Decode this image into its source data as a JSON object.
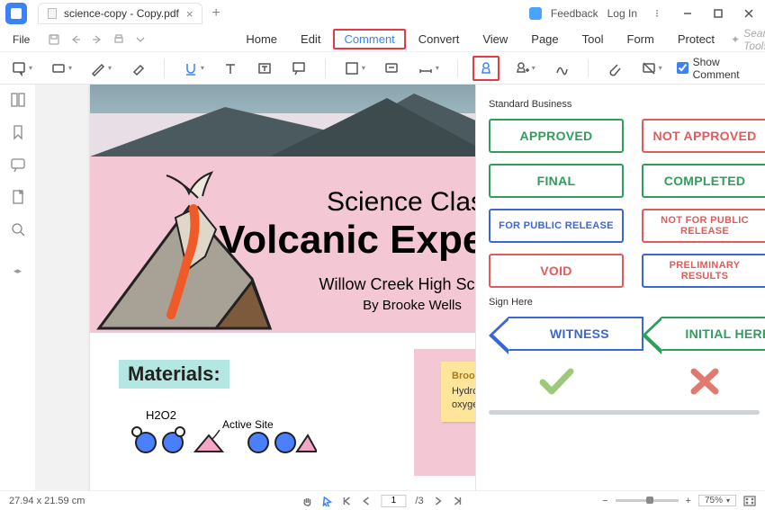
{
  "title": {
    "filename": "science-copy - Copy.pdf",
    "feedback": "Feedback",
    "login": "Log In"
  },
  "menu": {
    "file": "File",
    "tabs": [
      "Home",
      "Edit",
      "Comment",
      "Convert",
      "View",
      "Page",
      "Tool",
      "Form",
      "Protect"
    ],
    "active": 2,
    "search_placeholder": "Search Tools"
  },
  "toolbar": {
    "show_comment": "Show Comment"
  },
  "doc": {
    "line1": "Science Class",
    "line2": "Volcanic Experiment",
    "line3": "Willow Creek High School",
    "line4": "By Brooke Wells",
    "materials": "Materials:",
    "h2o2": "H2O2",
    "active_site": "Active Site",
    "sticky_author": "Brook Wells",
    "sticky_body": "Hydrogen peroxide naturally decompose into water and oxygen gas. The chemical equation for this decompostion is:"
  },
  "panel": {
    "section1": "Standard Business",
    "section2": "Sign Here",
    "stamps": {
      "approved": "APPROVED",
      "not_approved": "NOT APPROVED",
      "final": "FINAL",
      "completed": "COMPLETED",
      "public": "FOR PUBLIC RELEASE",
      "not_public": "NOT FOR PUBLIC RELEASE",
      "void": "VOID",
      "prelim": "PRELIMINARY RESULTS",
      "witness": "WITNESS",
      "initial": "INITIAL HERE"
    }
  },
  "status": {
    "dims": "27.94 x 21.59 cm",
    "page_current": "1",
    "page_total": "/3",
    "zoom": "75%"
  }
}
